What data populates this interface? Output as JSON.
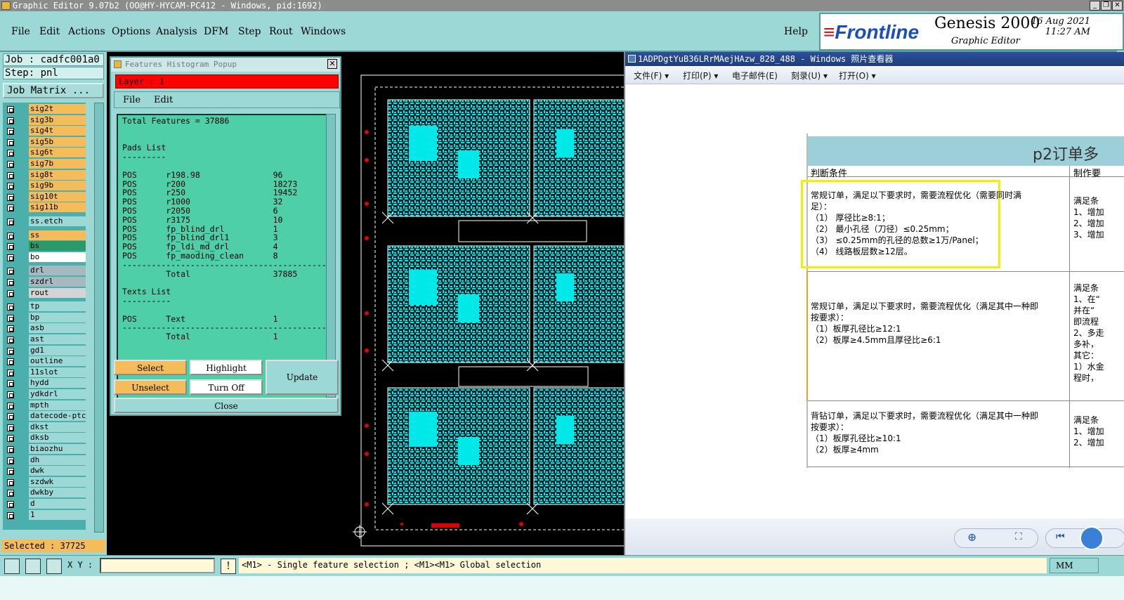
{
  "app": {
    "title": "Graphic Editor 9.07b2 (OO@HY-HYCAM-PC412 - Windows, pid:1692)"
  },
  "menu": {
    "items": [
      "File",
      "Edit",
      "Actions",
      "Options",
      "Analysis",
      "DFM",
      "Step",
      "Rout",
      "Windows"
    ],
    "help": "Help"
  },
  "logo": {
    "brand": "Frontline",
    "product": "Genesis 2000",
    "subtitle": "Graphic Editor",
    "date": "16 Aug 2021",
    "time": "11:27 AM"
  },
  "job": {
    "job_label": "Job : cadfc001a0",
    "step_label": "Step: pnl",
    "matrix_button": "Job Matrix ...",
    "selected_label": "Selected : 37725"
  },
  "layers": [
    {
      "name": "sig2t",
      "color": "#f4bc5a"
    },
    {
      "name": "sig3b",
      "color": "#f4bc5a"
    },
    {
      "name": "sig4t",
      "color": "#f4bc5a"
    },
    {
      "name": "sig5b",
      "color": "#f4bc5a"
    },
    {
      "name": "sig6t",
      "color": "#f4bc5a"
    },
    {
      "name": "sig7b",
      "color": "#f4bc5a"
    },
    {
      "name": "sig8t",
      "color": "#f4bc5a"
    },
    {
      "name": "sig9b",
      "color": "#f4bc5a"
    },
    {
      "name": "sig10t",
      "color": "#f4bc5a"
    },
    {
      "name": "sig11b",
      "color": "#f4bc5a"
    },
    {
      "name": "ss.etch",
      "color": "#9bd8d6"
    },
    {
      "name": "ss",
      "color": "#f4bc5a"
    },
    {
      "name": "bs",
      "color": "#2a9a6a"
    },
    {
      "name": "bo",
      "color": "#ffffff"
    },
    {
      "name": "drl",
      "color": "#a8b8c0"
    },
    {
      "name": "szdrl",
      "color": "#a8b8c0"
    },
    {
      "name": "rout",
      "color": "#d4d4d4"
    },
    {
      "name": "tp",
      "color": "#9bd8d6"
    },
    {
      "name": "bp",
      "color": "#9bd8d6"
    },
    {
      "name": "asb",
      "color": "#9bd8d6"
    },
    {
      "name": "ast",
      "color": "#9bd8d6"
    },
    {
      "name": "gd1",
      "color": "#9bd8d6"
    },
    {
      "name": "outline",
      "color": "#9bd8d6"
    },
    {
      "name": "11slot",
      "color": "#9bd8d6"
    },
    {
      "name": "hydd",
      "color": "#9bd8d6"
    },
    {
      "name": "ydkdrl",
      "color": "#9bd8d6"
    },
    {
      "name": "mpth",
      "color": "#9bd8d6"
    },
    {
      "name": "datecode-ptc",
      "color": "#9bd8d6"
    },
    {
      "name": "dkst",
      "color": "#9bd8d6"
    },
    {
      "name": "dksb",
      "color": "#9bd8d6"
    },
    {
      "name": "biaozhu",
      "color": "#9bd8d6"
    },
    {
      "name": "dh",
      "color": "#9bd8d6"
    },
    {
      "name": "dwk",
      "color": "#9bd8d6"
    },
    {
      "name": "szdwk",
      "color": "#9bd8d6"
    },
    {
      "name": "dwkby",
      "color": "#9bd8d6"
    },
    {
      "name": "d",
      "color": "#9bd8d6"
    },
    {
      "name": "1",
      "color": "#9bd8d6"
    }
  ],
  "popup": {
    "title": "Features Histogram Popup",
    "layer_label": "Layer :  1",
    "menu": [
      "File",
      "Edit"
    ],
    "total_features": "Total Features = 37886",
    "pads_heading": "Pads List",
    "pads": [
      [
        "POS",
        "r198.98",
        "96"
      ],
      [
        "POS",
        "r200",
        "18273"
      ],
      [
        "POS",
        "r250",
        "19452"
      ],
      [
        "POS",
        "r1000",
        "32"
      ],
      [
        "POS",
        "r2050",
        "6"
      ],
      [
        "POS",
        "r3175",
        "10"
      ],
      [
        "POS",
        "fp_blind_drl",
        "1"
      ],
      [
        "POS",
        "fp_blind_drl1",
        "3"
      ],
      [
        "POS",
        "fp_ldi_md_drl",
        "4"
      ],
      [
        "POS",
        "fp_maoding_clean",
        "8"
      ]
    ],
    "pads_total": [
      "Total",
      "37885"
    ],
    "texts_heading": "Texts List",
    "texts": [
      [
        "POS",
        "Text",
        "1"
      ]
    ],
    "texts_total": [
      "Total",
      "1"
    ],
    "buttons": {
      "select": "Select",
      "highlight": "Highlight",
      "update": "Update",
      "unselect": "Unselect",
      "turn_off": "Turn Off",
      "close": "Close"
    }
  },
  "photo": {
    "title": "1ADPDgtYuB36LRrMAejHAzw_828_488 - Windows 照片查看器",
    "menu": [
      "文件(F) ▾",
      "打印(P) ▾",
      "电子邮件(E)",
      "刻录(U) ▾",
      "打开(O) ▾"
    ],
    "doc_title": "p2订单多",
    "col1": "判断条件",
    "col2": "制作要",
    "row1": [
      "常规订单，满足以下要求时，需要流程优化（需要同时满",
      "足）：",
      "（1）  厚径比≥8:1；",
      "（2）  最小孔径（刀径）≤0.25mm；",
      "（3）  ≤0.25mm的孔径的总数≥1万/Panel；",
      "（4）  线路板层数≥12层。"
    ],
    "row1b": [
      "满足条",
      "1、增加",
      "2、增加",
      "3、增加"
    ],
    "row2": [
      "常规订单，满足以下要求时，需要流程优化（满足其中一种即",
      "按要求）：",
      "（1）板厚孔径比≥12:1",
      "（2）板厚≥4.5mm且厚径比≥6:1"
    ],
    "row2b": [
      "满足条",
      "1、在“",
      "并在“",
      "即流程",
      "2、多走",
      "多补，",
      "其它：",
      "1）水金",
      "程时，"
    ],
    "row3": [
      "背钻订单，满足以下要求时，需要流程优化（满足其中一种即",
      "按要求）：",
      "（1）板厚孔径比≥10:1",
      "（2）板厚≥4mm"
    ],
    "row3b": [
      "满足条",
      "1、增加",
      "2、增加"
    ]
  },
  "status": {
    "xy_label": "X Y :",
    "hint": "<M1> - Single feature selection ; <M1><M1> Global selection",
    "unit": "MM"
  },
  "colors": {
    "teal": "#9bd8d6",
    "orange": "#f4bc5a",
    "cyan_copper": "#00e8e8",
    "highlight": "#f0f000",
    "layer_red": "#ff0000"
  }
}
